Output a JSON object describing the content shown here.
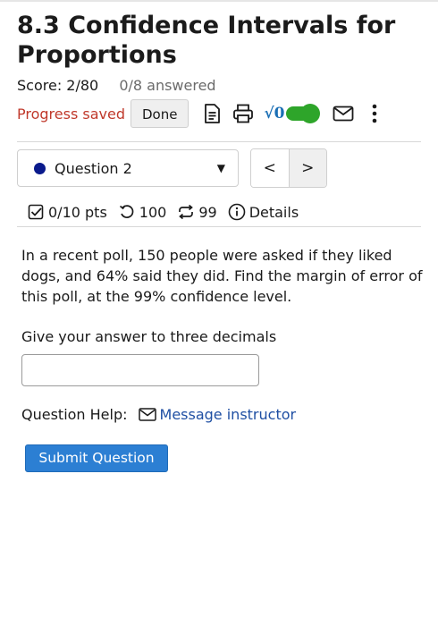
{
  "assignment": {
    "title": "8.3 Confidence Intervals for Proportions",
    "score": "Score: 2/80",
    "answered": "0/8 answered"
  },
  "status": {
    "progress_saved": "Progress saved",
    "done_label": "Done",
    "sqrt_label": "√0",
    "toggle_on": true
  },
  "question_nav": {
    "selected": "Question 2",
    "prev_label": "<",
    "next_label": ">",
    "dot_color": "#0a1a8c"
  },
  "stats": {
    "points": "0/10 pts",
    "attempts_left": "100",
    "versions_left": "99",
    "details_label": "Details"
  },
  "question": {
    "text": "In a recent poll, 150 people were asked if they liked dogs, and 64% said they did. Find the margin of error of this poll, at the 99% confidence level.",
    "instruction": "Give your answer to three decimals",
    "answer_value": "",
    "answer_placeholder": ""
  },
  "help": {
    "label": "Question Help:",
    "message_link": "Message instructor"
  },
  "submit": {
    "label": "Submit Question"
  },
  "colors": {
    "accent": "#2c7fd3",
    "saved": "#c0392b",
    "toggle": "#2ea52a",
    "link": "#1f4fa3"
  }
}
